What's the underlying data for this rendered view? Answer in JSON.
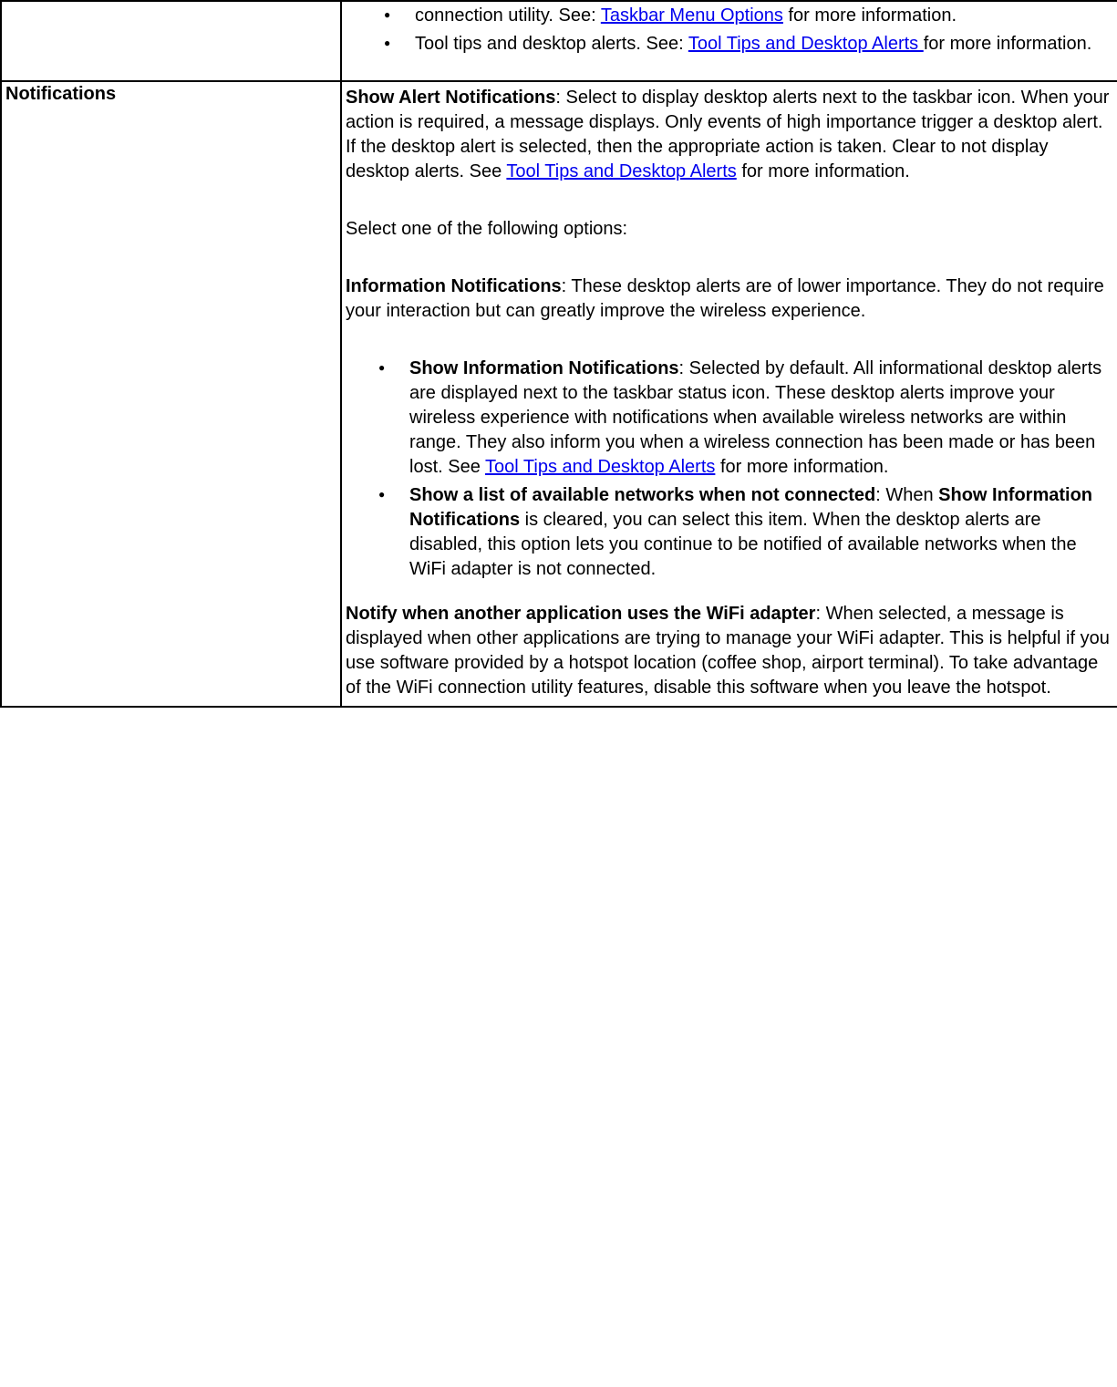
{
  "row1": {
    "bullet1_prefix": "connection utility. See: ",
    "bullet1_link": "Taskbar Menu Options",
    "bullet1_suffix": " for more information.",
    "bullet2_prefix": "Tool tips and desktop alerts. See: ",
    "bullet2_link": "Tool Tips and Desktop Alerts ",
    "bullet2_suffix": "for more information."
  },
  "row2": {
    "heading": "Notifications",
    "p1": {
      "bold": "Show Alert Notifications",
      "text1": ": Select to display desktop alerts next to the taskbar icon. When your action is required, a message displays. Only events of high importance trigger a desktop alert. If the desktop alert is selected, then the appropriate action is taken. Clear to not display desktop alerts. See ",
      "link": "Tool Tips and Desktop Alerts",
      "text2": " for more information."
    },
    "p2": "Select one of the following options:",
    "p3": {
      "bold": "Information Notifications",
      "text": ": These desktop alerts are of lower importance. They do not require your interaction but can greatly improve the wireless experience."
    },
    "bullets": {
      "b1": {
        "bold": "Show Information Notifications",
        "text1": ": Selected by default. All informational desktop alerts are displayed next to the taskbar status icon. These desktop alerts improve your wireless experience with notifications when available wireless networks are within range. They also inform you when a wireless connection has been made or has been lost. See ",
        "link": "Tool Tips and Desktop Alerts",
        "text2": " for more information."
      },
      "b2": {
        "bold1": "Show a list of available networks when not connected",
        "text1": ": When ",
        "bold2": "Show Information Notifications",
        "text2": " is cleared, you can select this item. When the desktop alerts are disabled, this option lets you continue to be notified of available networks when the WiFi adapter is not connected."
      }
    },
    "p4": {
      "bold": "Notify when another application uses the WiFi adapter",
      "text": ": When selected, a message is displayed when other applications are trying to manage your WiFi adapter. This is helpful if you use software provided by a hotspot location (coffee shop, airport terminal). To take advantage of the WiFi connection utility features, disable this software when you leave the hotspot."
    }
  }
}
